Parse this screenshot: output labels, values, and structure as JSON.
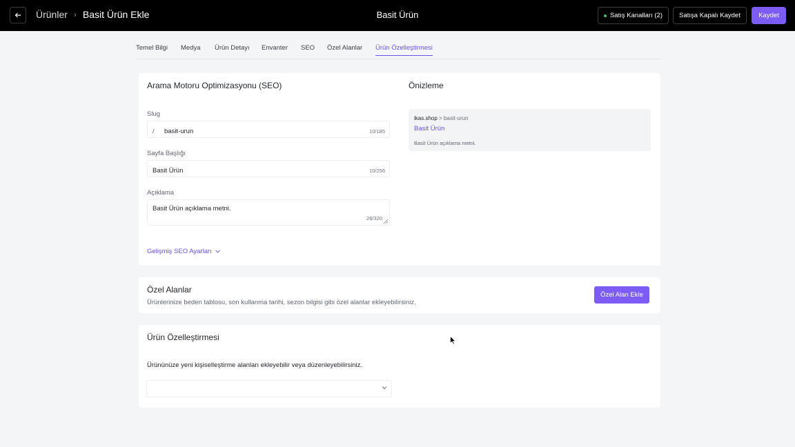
{
  "topbar": {
    "breadcrumb_parent": "Ürünler",
    "breadcrumb_current": "Basit Ürün Ekle",
    "page_title": "Basit Ürün",
    "sales_channels_label": "Satış Kanalları (2)",
    "save_closed_label": "Satışa Kapalı Kaydet",
    "save_label": "Kaydet"
  },
  "tabs": [
    {
      "label": "Temel Bilgi",
      "active": false
    },
    {
      "label": "Medya",
      "active": false
    },
    {
      "label": "Ürün Detayı",
      "active": false
    },
    {
      "label": "Envanter",
      "active": false
    },
    {
      "label": "SEO",
      "active": false
    },
    {
      "label": "Özel Alanlar",
      "active": false
    },
    {
      "label": "Ürün Özelleştirmesi",
      "active": true
    }
  ],
  "seo": {
    "title": "Arama Motoru Optimizasyonu (SEO)",
    "slug_label": "Slug",
    "slug_prefix": "/",
    "slug_value": "basit-urun",
    "slug_count": "10/185",
    "page_title_label": "Sayfa Başlığı",
    "page_title_value": "Basit Ürün",
    "page_title_count": "10/256",
    "description_label": "Açıklama",
    "description_value": "Basit Ürün açıklama metni.",
    "description_count": "26/320",
    "advanced_link": "Gelişmiş SEO Ayarları"
  },
  "preview": {
    "title": "Önizleme",
    "domain": "ikas.shop",
    "path": "> basit-urun",
    "page_title": "Basit Ürün",
    "description": "Basit Ürün açıklama metni."
  },
  "custom_fields": {
    "title": "Özel Alanlar",
    "description": "Ürünlerinize beden tablosu, son kullanma tarihi, sezon bilgisi gibi özel alanlar ekleyebilirsiniz.",
    "add_button": "Özel Alan Ekle"
  },
  "personalization": {
    "title": "Ürün Özelleştirmesi",
    "description": "Ürününüze yeni kişiselleştirme alanları ekleyebilir veya düzenleyebilirsiniz.",
    "select_value": ""
  },
  "colors": {
    "accent": "#7c5cf5",
    "topbar": "#000000",
    "background": "#f4f5f7",
    "status_dot": "#3ec46d"
  }
}
